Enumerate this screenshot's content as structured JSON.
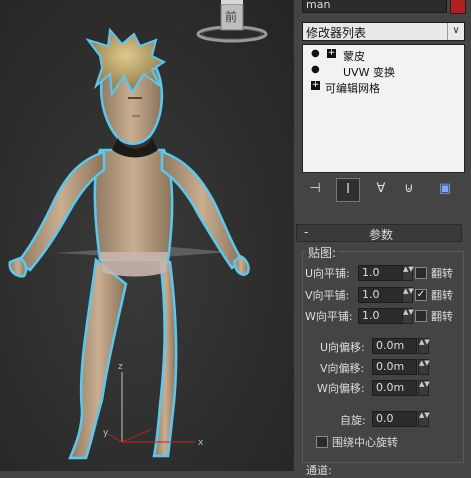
{
  "viewport": {
    "viewcube_label": "前",
    "axis": {
      "z": "z",
      "y": "y",
      "x": "x"
    }
  },
  "panel": {
    "object_name": "man",
    "object_color": "#b02020",
    "modifier_list": "修改器列表",
    "stack": [
      {
        "label": "蒙皮",
        "icon": "lightbulb-icon",
        "expand": "+"
      },
      {
        "label": "UVW 变换",
        "icon": "lightbulb-icon",
        "expand": ""
      },
      {
        "label": "可编辑网格",
        "icon": "",
        "expand": "+"
      }
    ],
    "toolbar_icons": [
      "pin-stack-icon",
      "show-end-result-icon",
      "make-unique-icon",
      "remove-modifier-icon",
      "configure-modifier-sets-icon"
    ],
    "rollout": {
      "collapse": "-",
      "title": "参数",
      "group_label": "贴图:",
      "tile_rows": [
        {
          "label": "U向平铺:",
          "value": "1.0",
          "checked": false,
          "flip": "翻转"
        },
        {
          "label": "V向平铺:",
          "value": "1.0",
          "checked": true,
          "flip": "翻转"
        },
        {
          "label": "W向平铺:",
          "value": "1.0",
          "checked": false,
          "flip": "翻转"
        }
      ],
      "offset_rows": [
        {
          "label": "U向偏移:",
          "value": "0.0m"
        },
        {
          "label": "V向偏移:",
          "value": "0.0m"
        },
        {
          "label": "W向偏移:",
          "value": "0.0m"
        }
      ],
      "rotation_label": "自旋:",
      "rotation_value": "0.0",
      "center_label": "围绕中心旋转",
      "center_checked": false,
      "channel_label": "通道:"
    }
  }
}
